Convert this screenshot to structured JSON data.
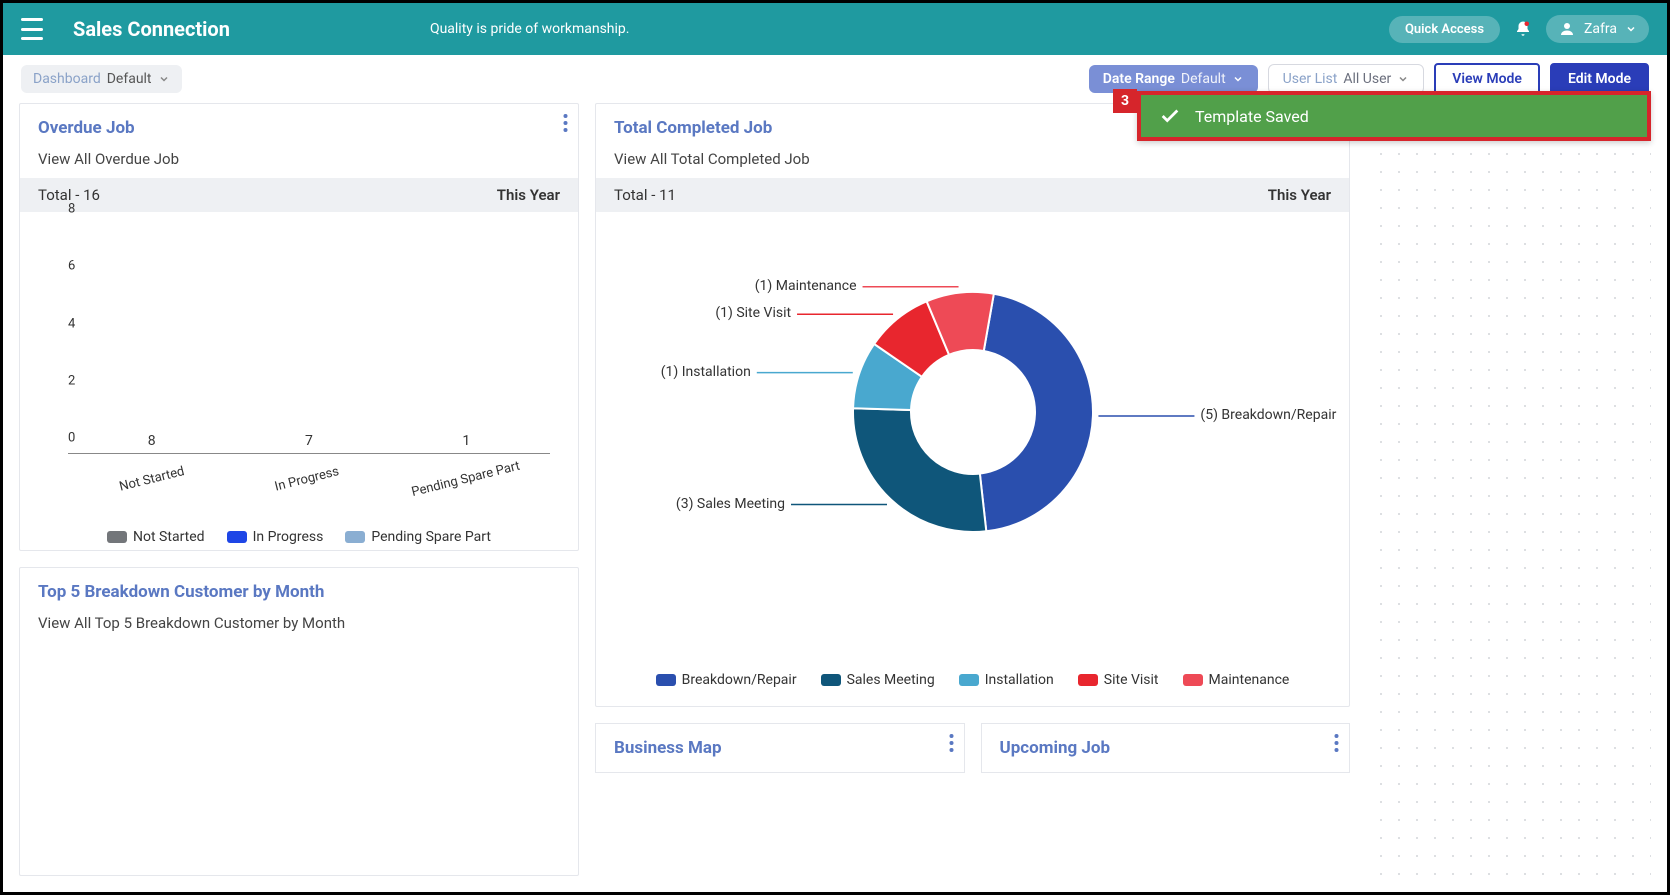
{
  "header": {
    "brand": "Sales Connection",
    "tagline": "Quality is pride of workmanship.",
    "quick_access": "Quick Access",
    "user": "Zafra"
  },
  "toolbar": {
    "dashboard_label": "Dashboard",
    "dashboard_value": "Default",
    "date_range_label": "Date Range",
    "date_range_value": "Default",
    "user_list_label": "User List",
    "user_list_value": "All User",
    "view_mode": "View Mode",
    "edit_mode": "Edit Mode"
  },
  "toast": {
    "number": "3",
    "text": "Template Saved"
  },
  "overdue": {
    "title": "Overdue Job",
    "subtitle": "View All Overdue Job",
    "total_label": "Total - 16",
    "period": "This Year"
  },
  "completed": {
    "title": "Total Completed Job",
    "subtitle": "View All Total Completed Job",
    "total_label": "Total - 11",
    "period": "This Year"
  },
  "breakdown_cust": {
    "title": "Top 5 Breakdown Customer by Month",
    "subtitle": "View All Top 5 Breakdown Customer by Month"
  },
  "biz_map": {
    "title": "Business Map"
  },
  "upcoming": {
    "title": "Upcoming Job"
  },
  "colors": {
    "not_started": "#73767a",
    "in_progress": "#1e46e6",
    "pending_spare": "#8aaed2",
    "breakdown": "#2a4fae",
    "sales_meeting": "#0f567a",
    "installation": "#49a8cf",
    "site_visit": "#e8262e",
    "maintenance": "#ee4a56"
  },
  "chart_data": [
    {
      "type": "bar",
      "title": "Overdue Job",
      "ylabel": "",
      "ylim": [
        0,
        8
      ],
      "yticks": [
        0,
        2,
        4,
        6,
        8
      ],
      "categories": [
        "Not Started",
        "In Progress",
        "Pending Spare Part"
      ],
      "values": [
        8,
        7,
        1
      ],
      "series_colors": [
        "#73767a",
        "#1e46e6",
        "#8aaed2"
      ],
      "legend": [
        "Not Started",
        "In Progress",
        "Pending Spare Part"
      ]
    },
    {
      "type": "donut",
      "title": "Total Completed Job",
      "series": [
        {
          "name": "Breakdown/Repair",
          "value": 5,
          "color": "#2a4fae",
          "label": "(5) Breakdown/Repair"
        },
        {
          "name": "Sales Meeting",
          "value": 3,
          "color": "#0f567a",
          "label": "(3) Sales Meeting"
        },
        {
          "name": "Installation",
          "value": 1,
          "color": "#49a8cf",
          "label": "(1) Installation"
        },
        {
          "name": "Site Visit",
          "value": 1,
          "color": "#e8262e",
          "label": "(1) Site Visit"
        },
        {
          "name": "Maintenance",
          "value": 1,
          "color": "#ee4a56",
          "label": "(1) Maintenance"
        }
      ],
      "legend": [
        "Breakdown/Repair",
        "Sales Meeting",
        "Installation",
        "Site Visit",
        "Maintenance"
      ]
    }
  ]
}
